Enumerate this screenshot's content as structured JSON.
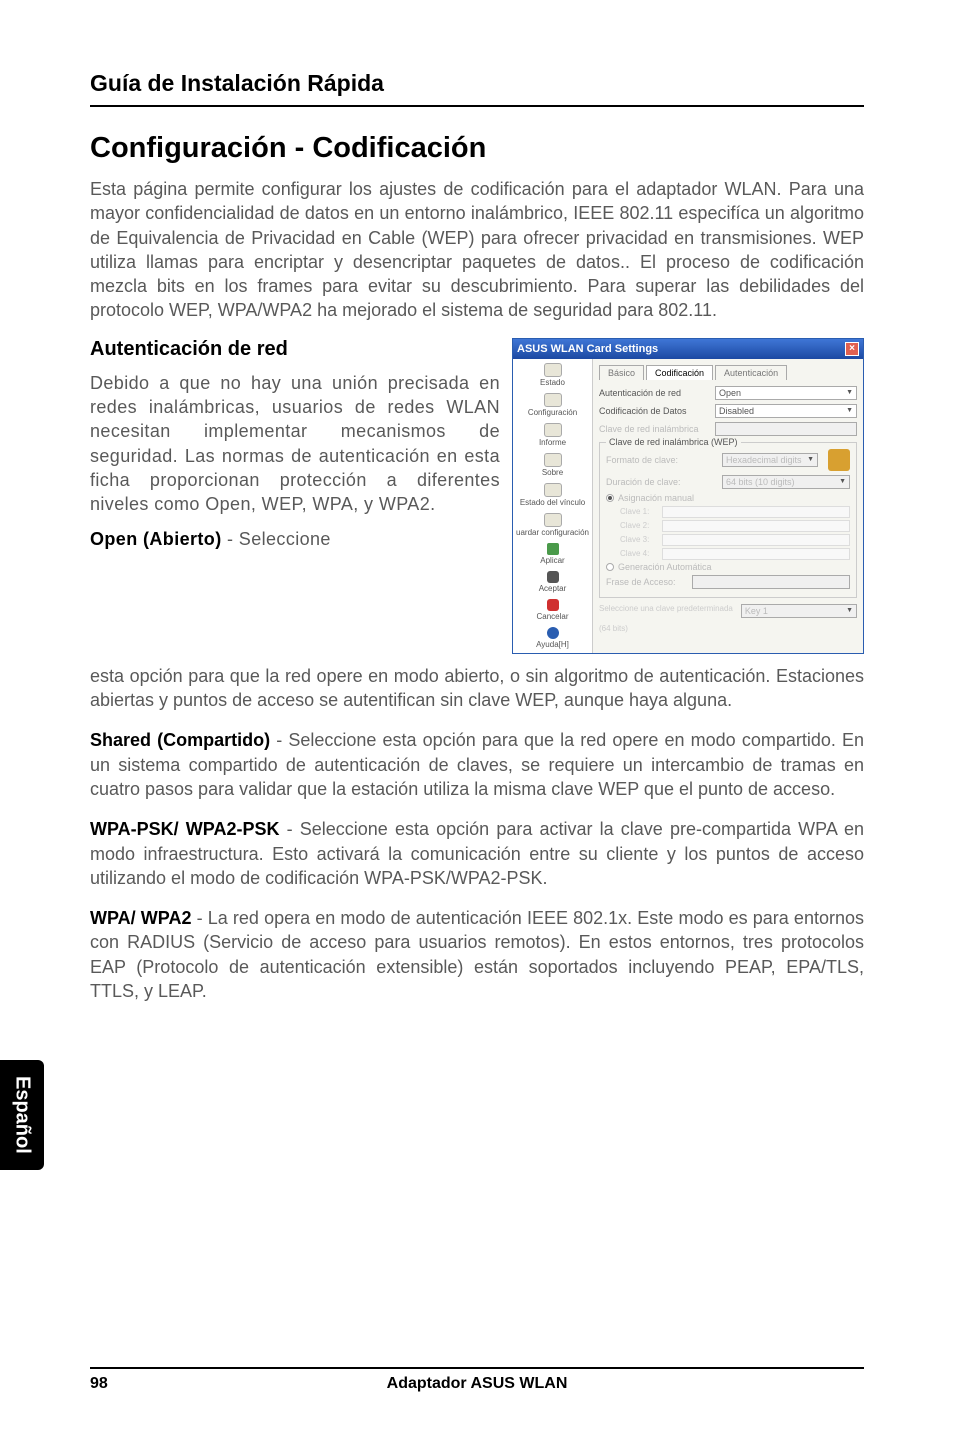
{
  "header": "Guía de Instalación Rápida",
  "title": "Configuración - Codificación",
  "intro": "Esta página permite configurar los ajustes de codificación para el adaptador WLAN. Para una mayor confidencialidad de datos en un entorno inalámbrico, IEEE 802.11 especifíca un algoritmo de Equivalencia de Privacidad en Cable (WEP) para ofrecer privacidad en transmisiones. WEP utiliza llamas para encriptar y desencriptar paquetes de datos.. El proceso de codificación mezcla bits en los frames para evitar su descubrimiento. Para superar las debilidades del protocolo WEP, WPA/WPA2 ha mejorado el sistema de seguridad para 802.11.",
  "subhead": "Autenticación de red",
  "leftcol": "Debido a que no hay una unión precisada en redes inalámbricas, usuarios de redes WLAN necesitan implementar mecanismos de seguridad. Las normas de autenticación en esta ficha proporcionan protección a diferentes niveles como Open, WEP, WPA, y WPA2.",
  "dialog": {
    "title": "ASUS WLAN Card Settings",
    "close": "×",
    "sidebar": {
      "estado": "Estado",
      "configuracion": "Configuración",
      "informe": "Informe",
      "sobre": "Sobre",
      "estado_vinculo": "Estado del vínculo",
      "guardar": "uardar configuración",
      "aplicar": "Aplicar",
      "aceptar": "Aceptar",
      "cancelar": "Cancelar",
      "ayuda": "Ayuda[H]"
    },
    "tabs": {
      "basico": "Básico",
      "codificacion": "Codificación",
      "autenticacion": "Autenticación"
    },
    "fields": {
      "autenticacion_red_label": "Autenticación de red",
      "autenticacion_red_value": "Open",
      "codificacion_datos_label": "Codificación de Datos",
      "codificacion_datos_value": "Disabled",
      "clave_red_label": "Clave de red inalámbrica",
      "group_title": "Clave de red inalámbrica (WEP)",
      "formato_label": "Formato de clave:",
      "formato_value": "Hexadecimal digits",
      "duracion_label": "Duración de clave:",
      "duracion_value": "64 bits (10 digits)",
      "asignacion_manual": "Asignación manual",
      "clave1": "Clave 1:",
      "clave2": "Clave 2:",
      "clave3": "Clave 3:",
      "clave4": "Clave 4:",
      "generacion_auto": "Generación Automática",
      "frase_acceso": "Frase de Acceso:",
      "seleccione_note": "Seleccione una clave predeterminada",
      "key1": "Key 1",
      "bits": "(64 bits)"
    }
  },
  "paras": {
    "open_bold": "Open (Abierto)",
    "open_dash": " - Seleccione",
    "open_rest": "esta opción para que la red opere en modo abierto, o sin algoritmo de autenticación. Estaciones abiertas y puntos de acceso se autentifican sin clave WEP, aunque haya alguna.",
    "shared_bold": "Shared (Compartido)",
    "shared_rest": " - Seleccione esta opción para que la red opere en modo compartido. En un sistema compartido de autenticación de claves, se requiere un intercambio de tramas en cuatro pasos para validar que la estación utiliza la misma clave WEP que el punto de acceso.",
    "wpapsk_bold": "WPA-PSK/ WPA2-PSK",
    "wpapsk_rest": " - Seleccione esta opción para activar la clave pre-compartida WPA en modo infraestructura. Esto activará la comunicación entre su cliente y los puntos de acceso utilizando el modo de codificación WPA-PSK/WPA2-PSK.",
    "wpa_bold": "WPA/ WPA2",
    "wpa_rest": " - La red opera en modo de autenticación IEEE 802.1x. Este modo es para entornos con RADIUS (Servicio de acceso para usuarios remotos). En estos entornos, tres protocolos EAP (Protocolo de autenticación extensible) están soportados incluyendo PEAP, EPA/TLS, TTLS, y LEAP."
  },
  "sidetab": "Español",
  "footer": {
    "page": "98",
    "center": "Adaptador ASUS WLAN"
  }
}
